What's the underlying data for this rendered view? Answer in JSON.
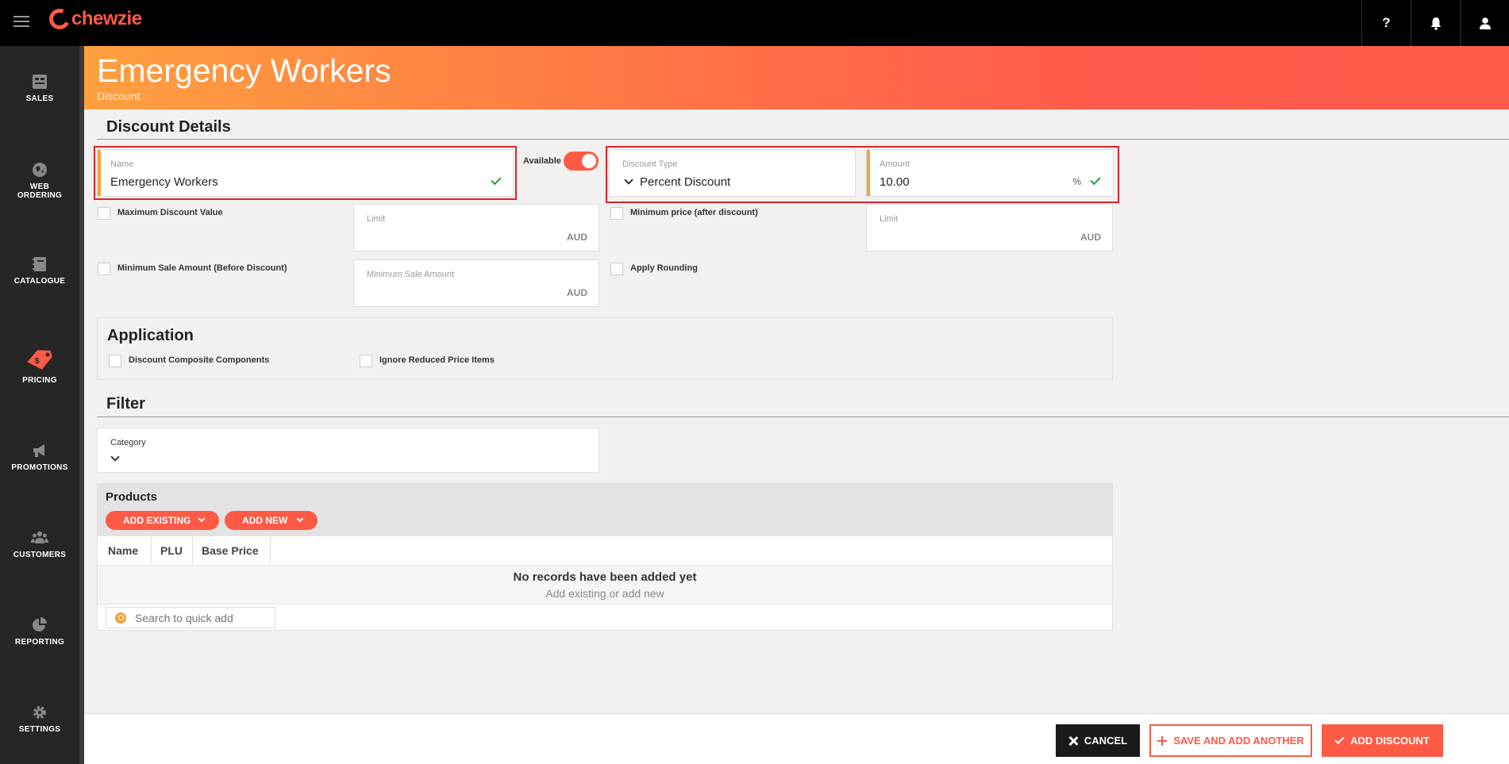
{
  "app": {
    "logo_text": "chewzie"
  },
  "topbar": {
    "help_label": "?"
  },
  "sidebar": {
    "items": [
      {
        "label": "SALES",
        "icon": "sales-icon"
      },
      {
        "label": "WEB",
        "label2": "ORDERING",
        "icon": "web-ordering-icon"
      },
      {
        "label": "CATALOGUE",
        "icon": "catalogue-icon"
      },
      {
        "label": "PRICING",
        "icon": "pricing-tag-icon",
        "active": true
      },
      {
        "label": "PROMOTIONS",
        "icon": "megaphone-icon"
      },
      {
        "label": "CUSTOMERS",
        "icon": "customers-icon"
      },
      {
        "label": "REPORTING",
        "icon": "pie-chart-icon"
      },
      {
        "label": "SETTINGS",
        "icon": "gear-icon"
      }
    ]
  },
  "header": {
    "title": "Emergency Workers",
    "subtitle": "Discount"
  },
  "details": {
    "title": "Discount Details",
    "name": {
      "label": "Name",
      "value": "Emergency Workers"
    },
    "available_label": "Available",
    "available": true,
    "discount_type": {
      "label": "Discount Type",
      "value": "Percent Discount"
    },
    "amount": {
      "label": "Amount",
      "value": "10.00",
      "unit": "%"
    },
    "max_discount": {
      "label": "Maximum Discount Value",
      "limit_label": "Limit",
      "unit": "AUD"
    },
    "min_price": {
      "label": "Minimum price (after discount)",
      "limit_label": "Limit",
      "unit": "AUD"
    },
    "min_sale": {
      "label": "Minimum Sale Amount (Before Discount)",
      "field_label": "Minimum Sale Amount",
      "unit": "AUD"
    },
    "apply_rounding": {
      "label": "Apply Rounding"
    }
  },
  "application": {
    "title": "Application",
    "composite_label": "Discount Composite Components",
    "ignore_reduced_label": "Ignore Reduced Price Items"
  },
  "filter": {
    "title": "Filter",
    "category_label": "Category"
  },
  "products": {
    "title": "Products",
    "add_existing": "ADD EXISTING",
    "add_new": "ADD NEW",
    "columns": [
      "Name",
      "PLU",
      "Base Price"
    ],
    "empty_title": "No records have been added yet",
    "empty_sub": "Add existing or add new",
    "search_placeholder": "Search to quick add"
  },
  "footer": {
    "cancel": "CANCEL",
    "save_another": "SAVE AND ADD ANOTHER",
    "add_discount": "ADD DISCOUNT"
  },
  "colors": {
    "accent": "#ff5a46",
    "field_bar": "#f2a33a",
    "success": "#2a9d3a"
  }
}
